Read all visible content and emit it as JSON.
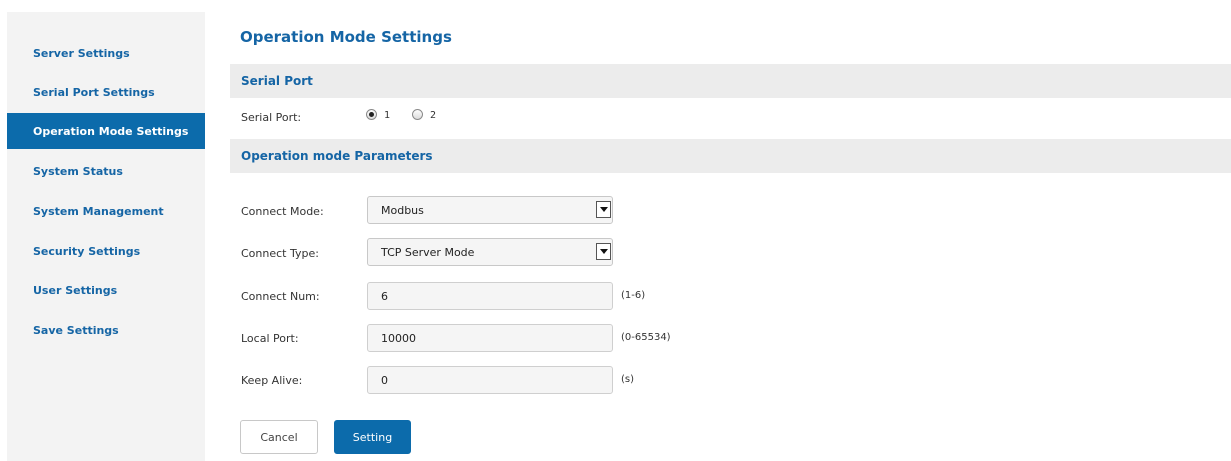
{
  "sidebar": {
    "items": [
      {
        "label": "Server Settings",
        "active": false
      },
      {
        "label": "Serial Port Settings",
        "active": false
      },
      {
        "label": "Operation Mode Settings",
        "active": true
      },
      {
        "label": "System Status",
        "active": false
      },
      {
        "label": "System Management",
        "active": false
      },
      {
        "label": "Security Settings",
        "active": false
      },
      {
        "label": "User Settings",
        "active": false
      },
      {
        "label": "Save Settings",
        "active": false
      }
    ]
  },
  "main": {
    "title": "Operation Mode Settings",
    "serial_section": {
      "header": "Serial Port",
      "label": "Serial Port:",
      "options": [
        {
          "label": "1",
          "checked": true
        },
        {
          "label": "2",
          "checked": false
        }
      ]
    },
    "params_section": {
      "header": "Operation mode Parameters",
      "connect_mode": {
        "label": "Connect Mode:",
        "value": "Modbus"
      },
      "connect_type": {
        "label": "Connect Type:",
        "value": "TCP Server Mode"
      },
      "connect_num": {
        "label": "Connect Num:",
        "value": "6",
        "hint": "(1-6)"
      },
      "local_port": {
        "label": "Local Port:",
        "value": "10000",
        "hint": "(0-65534)"
      },
      "keep_alive": {
        "label": "Keep Alive:",
        "value": "0",
        "hint": "(s)"
      }
    },
    "buttons": {
      "cancel": "Cancel",
      "setting": "Setting"
    }
  },
  "colors": {
    "accent": "#0c6bab",
    "link": "#1565a5",
    "sidebar_bg": "#f3f3f3",
    "section_bg": "#ececec"
  }
}
